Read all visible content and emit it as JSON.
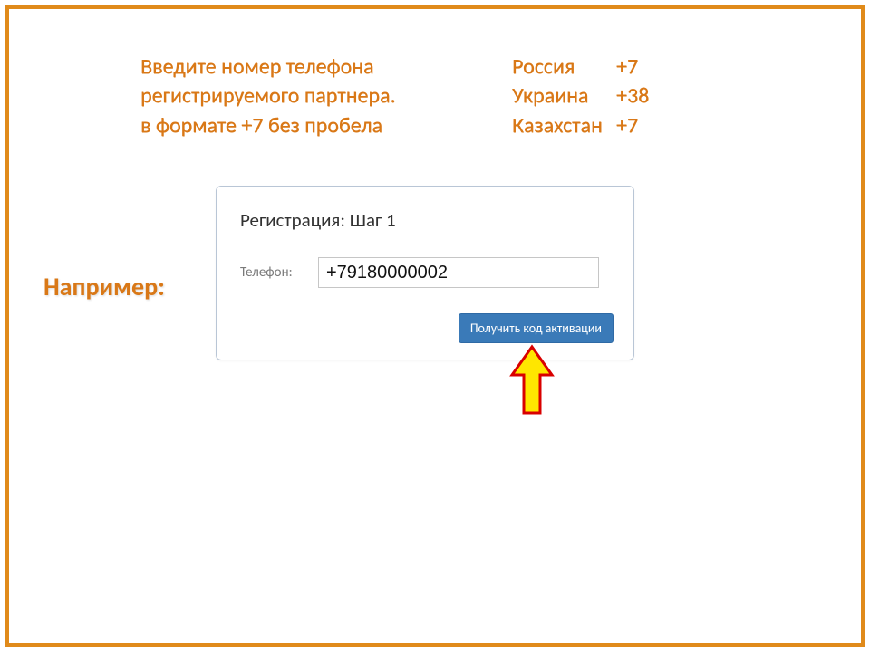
{
  "instructions": {
    "line1": "Введите номер телефона",
    "line2": "регистрируемого партнера.",
    "line3": "в формате +7 без пробела"
  },
  "country_codes": [
    {
      "name": "Россия",
      "code": "+7"
    },
    {
      "name": "Украина",
      "code": "+38"
    },
    {
      "name": "Казахстан",
      "code": "+7"
    }
  ],
  "example_label": "Например:",
  "form": {
    "title": "Регистрация: Шаг 1",
    "phone_label": "Телефон:",
    "phone_value": "+79180000002",
    "button_label": "Получить код активации"
  }
}
